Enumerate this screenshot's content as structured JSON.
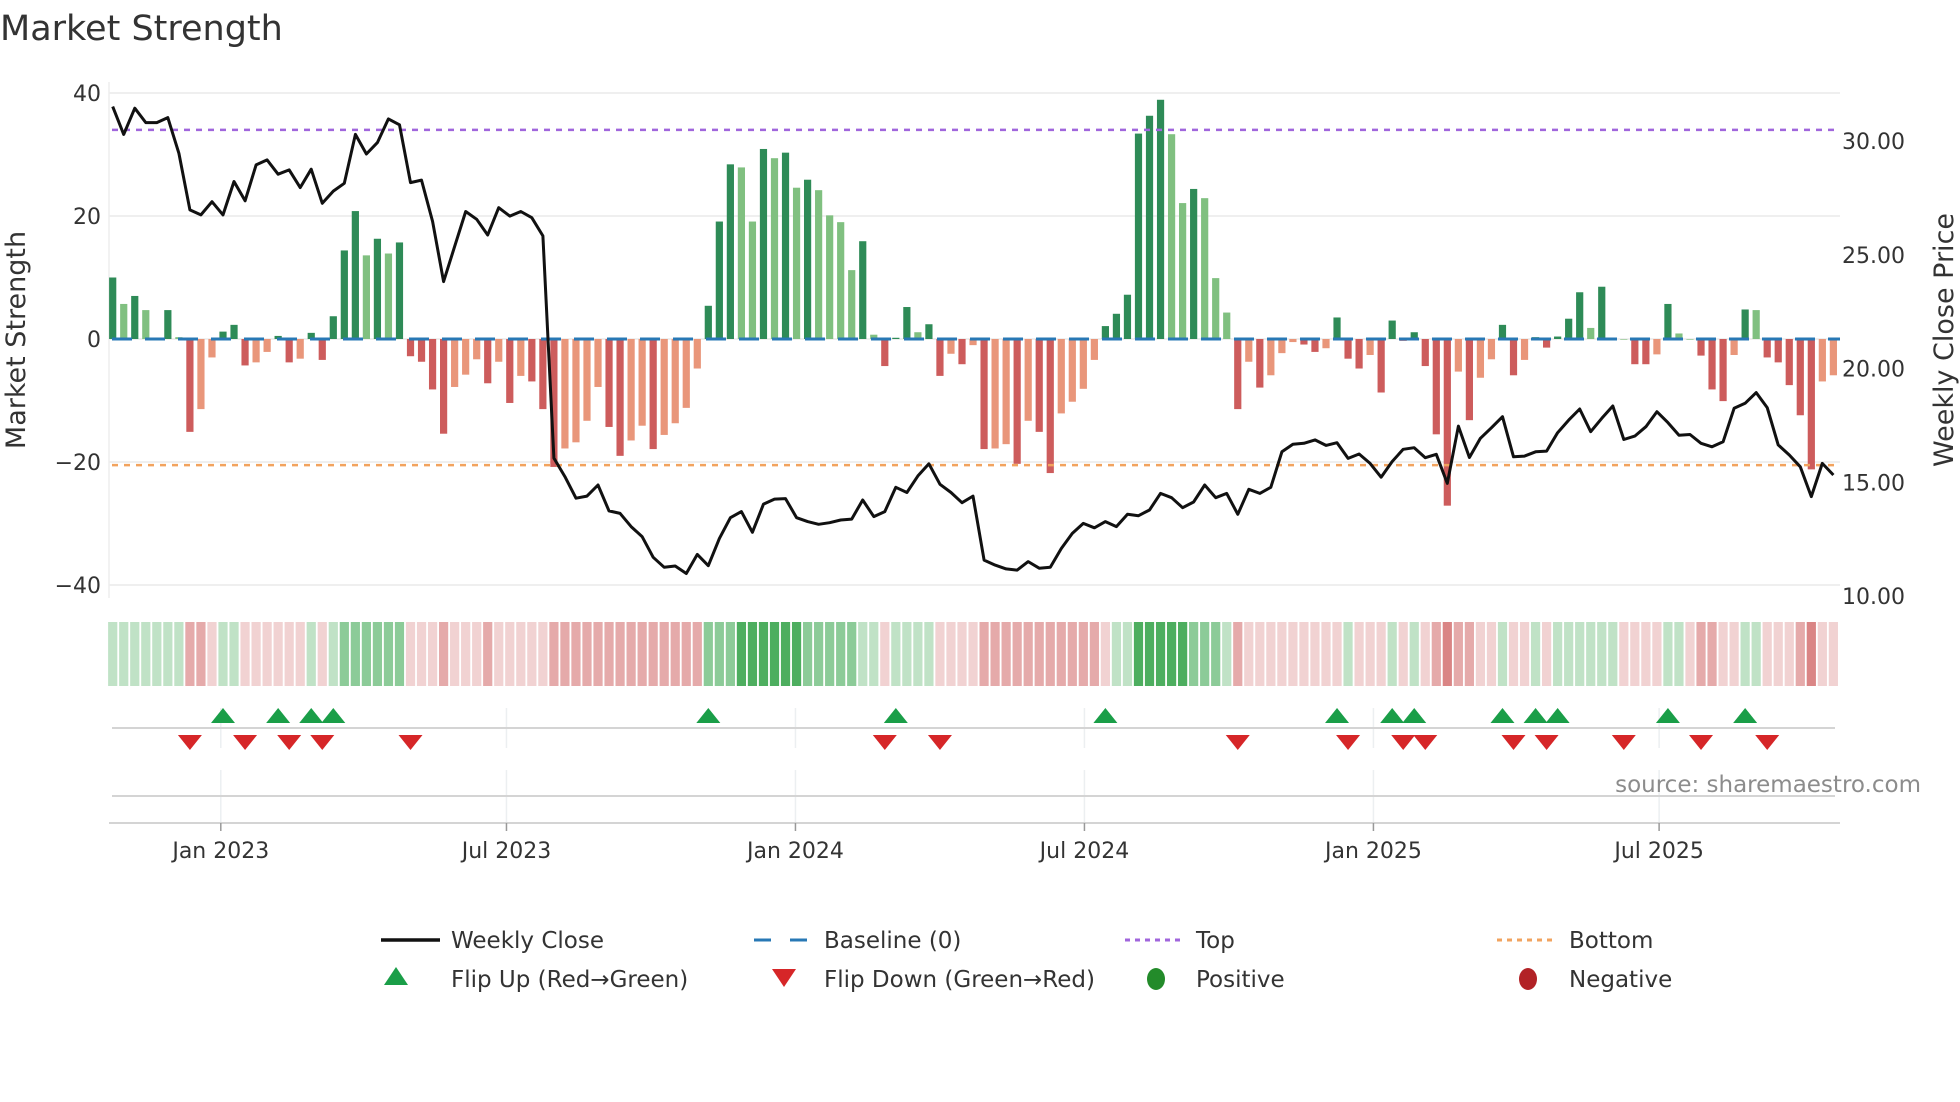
{
  "chart_data": {
    "type": "bar",
    "title": "Market Strength",
    "ylabel": "Market Strength",
    "y2label": "Weekly Close Price",
    "ylim": [
      -40,
      40
    ],
    "y2lim": [
      10,
      32.7
    ],
    "yticks": [
      {
        "value": 40,
        "label": "40"
      },
      {
        "value": 20,
        "label": "20"
      },
      {
        "value": 0,
        "label": "0"
      },
      {
        "value": -20,
        "label": "−20"
      },
      {
        "value": -40,
        "label": "−40"
      }
    ],
    "y2ticks": [
      {
        "value": 30,
        "label": "30.00"
      },
      {
        "value": 25,
        "label": "25.00"
      },
      {
        "value": 20,
        "label": "20.00"
      },
      {
        "value": 15,
        "label": "15.00"
      },
      {
        "value": 10,
        "label": "10.00"
      }
    ],
    "xticks": [
      {
        "week": 9.8,
        "label": "Jan 2023"
      },
      {
        "week": 35.7,
        "label": "Jul 2023"
      },
      {
        "week": 61.9,
        "label": "Jan 2024"
      },
      {
        "week": 88.1,
        "label": "Jul 2024"
      },
      {
        "week": 114.3,
        "label": "Jan 2025"
      },
      {
        "week": 140.2,
        "label": "Jul 2025"
      }
    ],
    "top_level": 34,
    "bottom_level": -20.5,
    "baseline": 0,
    "market_strength": [
      10.0,
      5.7,
      7.0,
      4.7,
      0,
      4.7,
      0.3,
      -15.1,
      -11.4,
      -3.0,
      1.2,
      2.3,
      -4.3,
      -3.8,
      -2.1,
      0.5,
      -3.8,
      -3.2,
      1.0,
      -3.4,
      3.7,
      14.4,
      20.8,
      13.6,
      16.3,
      13.9,
      15.7,
      -2.8,
      -3.7,
      -8.2,
      -15.4,
      -7.8,
      -5.8,
      -3.3,
      -7.2,
      -3.7,
      -10.4,
      -6.0,
      -6.9,
      -11.4,
      -20.8,
      -17.8,
      -16.8,
      -13.3,
      -7.8,
      -14.3,
      -19.0,
      -16.5,
      -14.1,
      -17.9,
      -15.6,
      -13.7,
      -11.2,
      -4.8,
      5.4,
      19.1,
      28.4,
      27.9,
      19.1,
      30.9,
      29.4,
      30.3,
      24.6,
      25.9,
      24.2,
      20.1,
      19.0,
      11.2,
      15.9,
      0.7,
      -4.4,
      0.2,
      5.2,
      1.1,
      2.4,
      -6.0,
      -2.4,
      -4.1,
      -1.0,
      -17.9,
      -17.8,
      -17.1,
      -20.3,
      -13.3,
      -15.1,
      -21.8,
      -12.1,
      -10.2,
      -8.1,
      -3.4,
      2.1,
      4.1,
      7.2,
      33.4,
      36.3,
      38.9,
      33.3,
      22.1,
      24.4,
      22.9,
      9.9,
      4.3,
      -11.4,
      -3.7,
      -7.9,
      -5.9,
      -2.3,
      -0.5,
      -0.9,
      -2.1,
      -1.5,
      3.5,
      -3.2,
      -4.8,
      -2.6,
      -8.7,
      3.0,
      -0.3,
      1.1,
      -4.4,
      -15.5,
      -27.1,
      -5.3,
      -13.2,
      -6.3,
      -3.3,
      2.3,
      -5.9,
      -3.4,
      0.3,
      -1.4,
      0.4,
      3.3,
      7.6,
      1.8,
      8.5,
      0.2,
      0,
      -4.1,
      -4.1,
      -2.5,
      5.7,
      0.9,
      0,
      -2.7,
      -8.2,
      -10.1,
      -2.6,
      4.8,
      4.7,
      -3.0,
      -3.8,
      -7.5,
      -12.4,
      -21.2,
      -6.9,
      -5.9
    ],
    "weekly_close": [
      31.51,
      30.29,
      31.44,
      30.81,
      30.81,
      31.03,
      29.46,
      26.97,
      26.75,
      27.33,
      26.75,
      28.22,
      27.37,
      28.95,
      29.17,
      28.54,
      28.73,
      27.95,
      28.76,
      27.26,
      27.8,
      28.14,
      30.29,
      29.43,
      29.93,
      30.97,
      30.71,
      28.17,
      28.28,
      26.46,
      23.82,
      25.36,
      26.9,
      26.56,
      25.87,
      27.07,
      26.7,
      26.9,
      26.63,
      25.83,
      16.06,
      15.25,
      14.3,
      14.39,
      14.88,
      13.74,
      13.63,
      13.05,
      12.61,
      11.7,
      11.26,
      11.32,
      10.99,
      11.83,
      11.33,
      12.53,
      13.44,
      13.71,
      12.8,
      14.04,
      14.26,
      14.28,
      13.44,
      13.27,
      13.15,
      13.22,
      13.34,
      13.38,
      14.22,
      13.49,
      13.71,
      14.78,
      14.55,
      15.28,
      15.81,
      14.91,
      14.55,
      14.1,
      14.39,
      11.58,
      11.36,
      11.19,
      11.14,
      11.51,
      11.22,
      11.26,
      12.09,
      12.75,
      13.19,
      13.0,
      13.27,
      13.05,
      13.59,
      13.53,
      13.78,
      14.51,
      14.32,
      13.88,
      14.13,
      14.88,
      14.32,
      14.51,
      13.59,
      14.69,
      14.51,
      14.78,
      16.34,
      16.67,
      16.71,
      16.86,
      16.62,
      16.74,
      16.05,
      16.24,
      15.83,
      15.22,
      15.91,
      16.45,
      16.52,
      16.08,
      16.23,
      14.95,
      17.47,
      16.09,
      16.93,
      17.4,
      17.88,
      16.12,
      16.15,
      16.34,
      16.37,
      17.18,
      17.73,
      18.22,
      17.22,
      17.81,
      18.35,
      16.88,
      17.03,
      17.44,
      18.1,
      17.62,
      17.07,
      17.1,
      16.71,
      16.56,
      16.78,
      18.25,
      18.47,
      18.94,
      18.28,
      16.64,
      16.2,
      15.68,
      14.37,
      15.83,
      15.32
    ],
    "regime_strip": [
      1,
      1,
      1,
      1,
      1,
      1,
      1,
      -2,
      -2,
      -1,
      1,
      1,
      -1,
      -1,
      -1,
      -1,
      -1,
      -1,
      1,
      -1,
      1,
      2,
      2,
      2,
      2,
      2,
      2,
      -1,
      -1,
      -1,
      -2,
      -1,
      -1,
      -1,
      -2,
      -1,
      -1,
      -1,
      -1,
      -1,
      -2,
      -2,
      -2,
      -2,
      -2,
      -2,
      -2,
      -2,
      -2,
      -2,
      -2,
      -2,
      -2,
      -2,
      2,
      2,
      2,
      3,
      3,
      3,
      3,
      3,
      3,
      2,
      2,
      2,
      2,
      2,
      1,
      1,
      -1,
      1,
      1,
      1,
      1,
      -1,
      -1,
      -1,
      -1,
      -2,
      -2,
      -2,
      -2,
      -2,
      -2,
      -2,
      -2,
      -2,
      -2,
      -2,
      -1,
      1,
      1,
      3,
      3,
      3,
      3,
      3,
      2,
      2,
      2,
      1,
      -2,
      -1,
      -1,
      -1,
      -1,
      -1,
      -1,
      -1,
      -1,
      -1,
      1,
      -1,
      -1,
      -1,
      1,
      -1,
      1,
      -1,
      -2,
      -3,
      -2,
      -2,
      -1,
      -1,
      1,
      -1,
      -1,
      1,
      -1,
      1,
      1,
      1,
      1,
      1,
      1,
      -1,
      -1,
      -1,
      -1,
      1,
      1,
      -1,
      -2,
      -2,
      -1,
      -1,
      1,
      1,
      -1,
      -1,
      -1,
      -2,
      -3,
      -1,
      -1
    ],
    "flip_up_weeks": [
      11,
      16,
      19,
      21,
      55,
      72,
      91,
      112,
      117,
      119,
      127,
      130,
      132,
      142,
      149
    ],
    "flip_down_weeks": [
      8,
      13,
      17,
      20,
      28,
      71,
      76,
      103,
      113,
      118,
      120,
      128,
      131,
      138,
      145,
      151
    ],
    "legend": [
      {
        "label": "Weekly Close",
        "kind": "line-solid",
        "color": "#111111"
      },
      {
        "label": "Baseline (0)",
        "kind": "line-dashed",
        "color": "#2878b5"
      },
      {
        "label": "Top",
        "kind": "line-dotted",
        "color": "#a066dc"
      },
      {
        "label": "Bottom",
        "kind": "line-dotted",
        "color": "#f2a35e"
      },
      {
        "label": "Flip Up (Red→Green)",
        "kind": "triangle-up",
        "color": "#1a9e48"
      },
      {
        "label": "Flip Down (Green→Red)",
        "kind": "triangle-down",
        "color": "#d62628"
      },
      {
        "label": "Positive",
        "kind": "dot",
        "color": "#238b2a"
      },
      {
        "label": "Negative",
        "kind": "dot",
        "color": "#b22226"
      }
    ],
    "legend_placement": "bottom",
    "grid": true,
    "colors": {
      "pos_rising": "#2e8b57",
      "pos_falling": "#80c080",
      "neg_rising": "#cd5c5c",
      "neg_falling": "#e9967a",
      "strip_pos": "46,160,67",
      "strip_neg": "205,92,92"
    },
    "source": "source: sharemaestro.com"
  }
}
